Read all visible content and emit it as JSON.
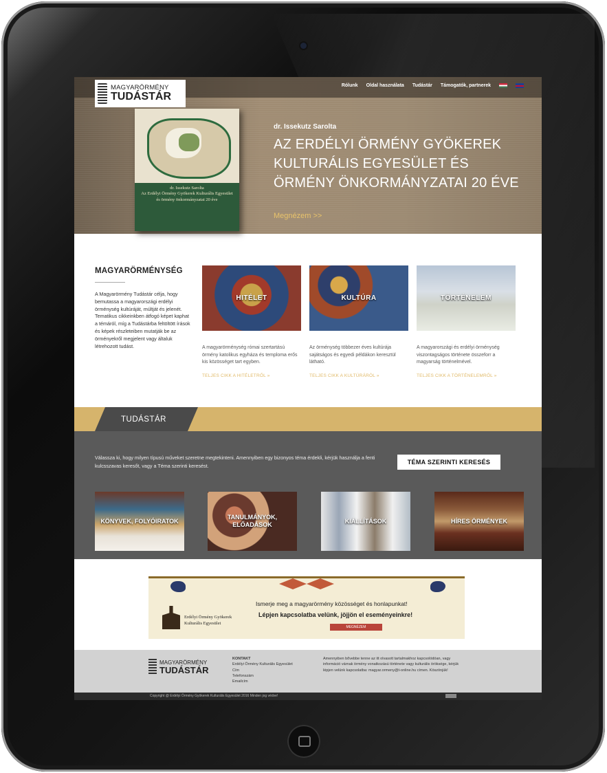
{
  "header": {
    "logo_line1": "MAGYARÖRMÉNY",
    "logo_line2": "TUDÁSTÁR",
    "menu": [
      "Rólunk",
      "Oldal használata",
      "Tudástár",
      "Támogatók, partnerek"
    ]
  },
  "hero": {
    "author": "dr. Issekutz Sarolta",
    "title": "AZ ERDÉLYI ÖRMÉNY GYÖKEREK KULTURÁLIS EGYESÜLET ÉS ÖRMÉNY ÖNKORMÁNYZATAI 20 ÉVE",
    "more_link": "Megnézem >>",
    "book_text": "dr. Issekutz Sarolta\nAz Erdélyi Örmény Gyökerek Kulturális Egyesület\nés örmény önkormányzatai 20 éve"
  },
  "intro": {
    "heading": "MAGYARÖRMÉNYSÉG",
    "text": "A Magyarörmény Tudástár célja, hogy bemutassa a magyarországi erdélyi örménység kultúráját, múltját és jelenét. Tematikus cikkeinkben átfogó képet kaphat a témáról, míg a Tudástárba feltöltött írások és képek részleteiben mutatják be az örményekről megjelent vagy általuk létrehozott tudást."
  },
  "cards": [
    {
      "title": "HITÉLET",
      "desc": "A magyarörménység római szertartású örmény katolikus egyháza és temploma erős kis közösséget tart egyben.",
      "link": "TELJES CIKK A HITÉLETRŐL »"
    },
    {
      "title": "KULTÚRA",
      "desc": "Az örménység többezer éves kultúrája sajátságos és egyedi példákon keresztül látható.",
      "link": "TELJES CIKK A KULTÚRÁRÓL »"
    },
    {
      "title": "TÖRTÉNELEM",
      "desc": "A magyarországi és erdélyi örménység viszontagságos története összeforr a magyarság történelmével.",
      "link": "TELJES CIKK A TÖRTÉNELEMRŐL »"
    }
  ],
  "tudastar": {
    "heading": "TUDÁSTÁR",
    "text": "Válassza ki, hogy milyen típusú műveket szeretne megtekinteni. Amennyiben egy bizonyos téma érdekli, kérjük használja a fenti kulcsszavas keresőt, vagy a Téma szerinti keresést.",
    "button": "TÉMA SZERINTI KERESÉS",
    "tiles": [
      "KÖNYVEK, FOLYÓIRATOK",
      "TANULMÁNYOK, ELŐADÁSOK",
      "KIÁLLÍTÁSOK",
      "HÍRES ÖRMÉNYEK"
    ]
  },
  "banner": {
    "line1": "Ismerje meg a magyarörmény közösséget és honlapunkat!",
    "line2": "Lépjen kapcsolatba velünk, jöjjön el eseményeinkre!",
    "cta": "MEGNÉZEM",
    "org": "Erdélyi Örmény Gyökerek Kulturális Egyesület"
  },
  "footer": {
    "logo_line1": "MAGYARÖRMÉNY",
    "logo_line2": "TUDÁSTÁR",
    "contact_heading": "KONTAKT",
    "contact_lines": [
      "Erdélyi Örmény Kulturális Egyesület",
      "Cím",
      "Telefonszám",
      "Emailcím"
    ],
    "note": "Amennyiben bővebbe tenne az itt olvasott tartalmakhoz kapcsolódóan, vagy információ várnak örmény vonatkozású története vagy kulturális öröksége, kérjük lépjen velünk kapcsolatba: magyar.ormeny@t-online.hu címen. Köszönjük!",
    "copyright": "Copyright @ Erdélyi Örmény Gyökerek Kulturális Egyesület 2016 Minden jog védve!"
  },
  "colors": {
    "gold": "#d6b46c",
    "dark_band": "#5a5a5a",
    "link_gold": "#e0b967"
  }
}
